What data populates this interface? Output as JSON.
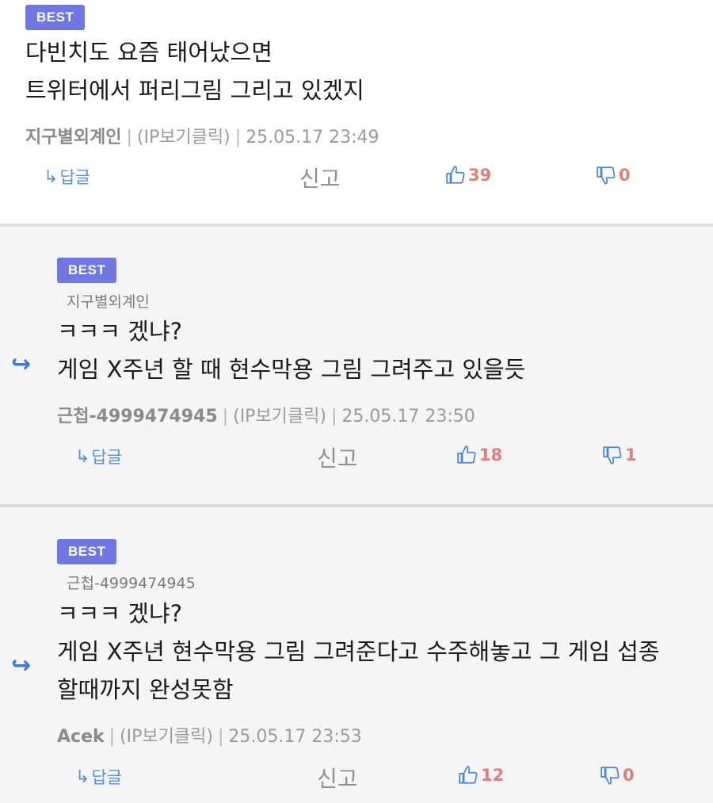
{
  "comments": [
    {
      "badge": "BEST",
      "parent_name": "",
      "content": "다빈치도 요즘 태어났으면\n트위터에서 퍼리그림 그리고 있겠지",
      "author": "지구별외계인",
      "ip": "(IP보기클릭)",
      "datetime": "25.05.17 23:49",
      "reply_label": "답글",
      "report_label": "신고",
      "likes": "39",
      "dislikes": "0"
    },
    {
      "badge": "BEST",
      "parent_name": "지구별외계인",
      "content": "ㅋㅋㅋ 겠냐?\n게임 X주년 할 때 현수막용 그림 그려주고 있을듯",
      "author": "근첩-4999474945",
      "ip": "(IP보기클릭)",
      "datetime": "25.05.17 23:50",
      "reply_label": "답글",
      "report_label": "신고",
      "likes": "18",
      "dislikes": "1"
    },
    {
      "badge": "BEST",
      "parent_name": "근첩-4999474945",
      "content": "ㅋㅋㅋ 겠냐?\n게임 X주년 현수막용 그림 그려준다고 수주해놓고 그 게임 섭종\n할때까지 완성못함",
      "author": "Acek",
      "ip": "(IP보기클릭)",
      "datetime": "25.05.17 23:53",
      "reply_label": "답글",
      "report_label": "신고",
      "likes": "12",
      "dislikes": "0"
    }
  ],
  "icons": {
    "reply_arrow": "reply-arrow-icon",
    "thumbs_up": "thumbs-up-icon",
    "thumbs_down": "thumbs-down-icon",
    "reply_marker": "reply-indent-icon"
  },
  "colors": {
    "badge": "#6f78e2",
    "like": "#e07d7d",
    "link": "#5a8fd8",
    "reply_bg": "#f5f5f8"
  }
}
